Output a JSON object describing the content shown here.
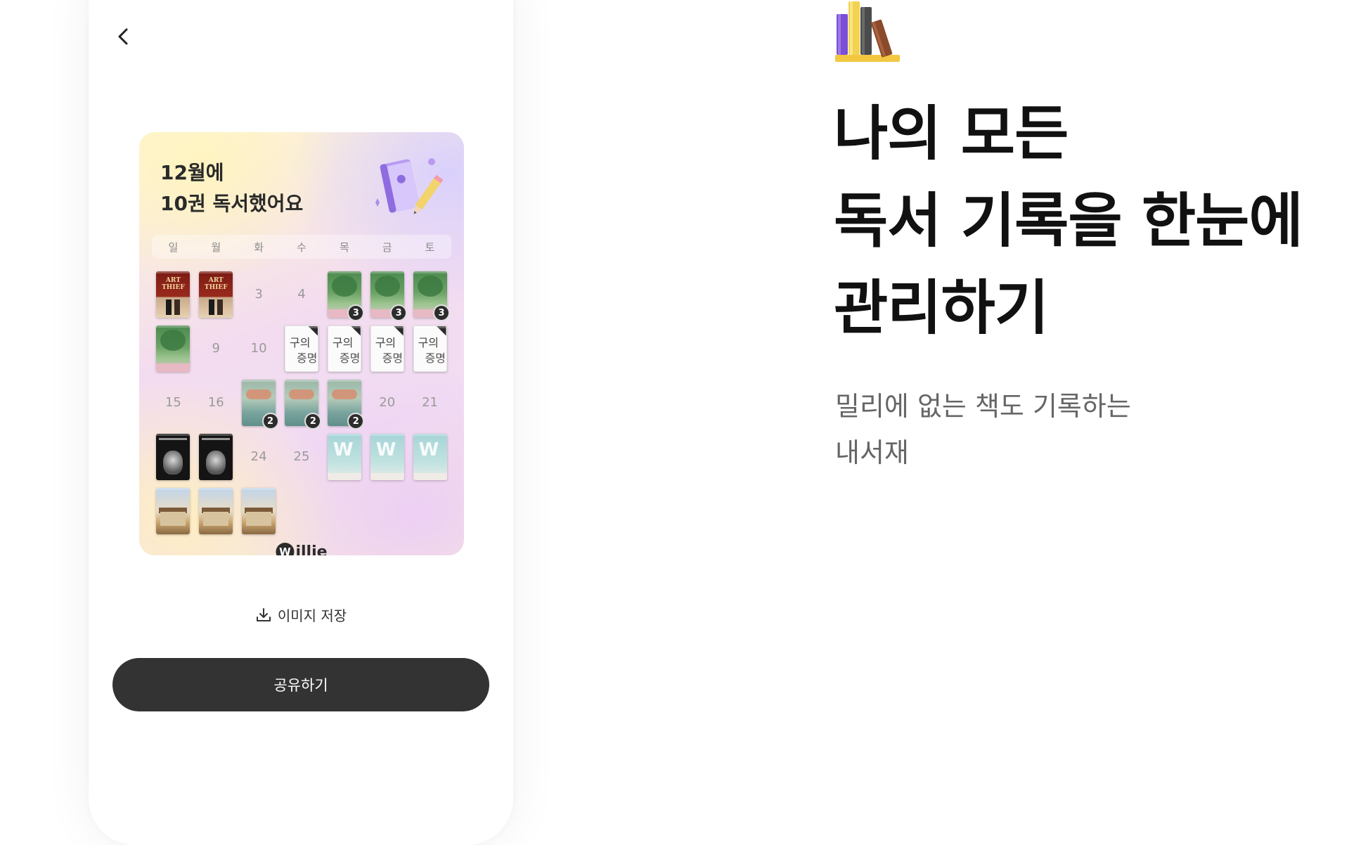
{
  "phone": {
    "back_icon": "chevron-left-icon",
    "card": {
      "title_line1": "12월에",
      "title_line2": "10권 독서했어요",
      "weekdays": [
        "일",
        "월",
        "화",
        "수",
        "목",
        "금",
        "토"
      ],
      "days": [
        {
          "type": "cover",
          "style": "art",
          "cover_text": "ART THIEF"
        },
        {
          "type": "cover",
          "style": "art",
          "cover_text": "ART THIEF"
        },
        {
          "type": "num",
          "label": "3"
        },
        {
          "type": "num",
          "label": "4"
        },
        {
          "type": "cover",
          "style": "tree",
          "badge": "3"
        },
        {
          "type": "cover",
          "style": "tree",
          "badge": "3"
        },
        {
          "type": "cover",
          "style": "tree",
          "badge": "3"
        },
        {
          "type": "cover",
          "style": "tree"
        },
        {
          "type": "num",
          "label": "9"
        },
        {
          "type": "num",
          "label": "10"
        },
        {
          "type": "cover",
          "style": "white",
          "cover_text1": "구의",
          "cover_text2": "증명"
        },
        {
          "type": "cover",
          "style": "white",
          "cover_text1": "구의",
          "cover_text2": "증명"
        },
        {
          "type": "cover",
          "style": "white",
          "cover_text1": "구의",
          "cover_text2": "증명"
        },
        {
          "type": "cover",
          "style": "white",
          "cover_text1": "구의",
          "cover_text2": "증명"
        },
        {
          "type": "num",
          "label": "15"
        },
        {
          "type": "num",
          "label": "16"
        },
        {
          "type": "cover",
          "style": "teal",
          "badge": "2"
        },
        {
          "type": "cover",
          "style": "teal",
          "badge": "2"
        },
        {
          "type": "cover",
          "style": "teal",
          "badge": "2"
        },
        {
          "type": "num",
          "label": "20"
        },
        {
          "type": "num",
          "label": "21"
        },
        {
          "type": "cover",
          "style": "dark"
        },
        {
          "type": "cover",
          "style": "dark"
        },
        {
          "type": "num",
          "label": "24"
        },
        {
          "type": "num",
          "label": "25"
        },
        {
          "type": "cover",
          "style": "sky"
        },
        {
          "type": "cover",
          "style": "sky"
        },
        {
          "type": "cover",
          "style": "sky"
        },
        {
          "type": "cover",
          "style": "town"
        },
        {
          "type": "cover",
          "style": "town"
        },
        {
          "type": "cover",
          "style": "town"
        }
      ],
      "logo_mark": "W",
      "logo_text": "illie"
    },
    "save_icon": "download-icon",
    "save_label": "이미지 저장",
    "share_label": "공유하기"
  },
  "hero": {
    "icon": "books-icon",
    "headline_line1": "나의 모든",
    "headline_line2": "독서 기록을 한눈에",
    "headline_line3": "관리하기",
    "sub_line1": "밀리에 없는 책도 기록하는",
    "sub_line2": "내서재"
  }
}
